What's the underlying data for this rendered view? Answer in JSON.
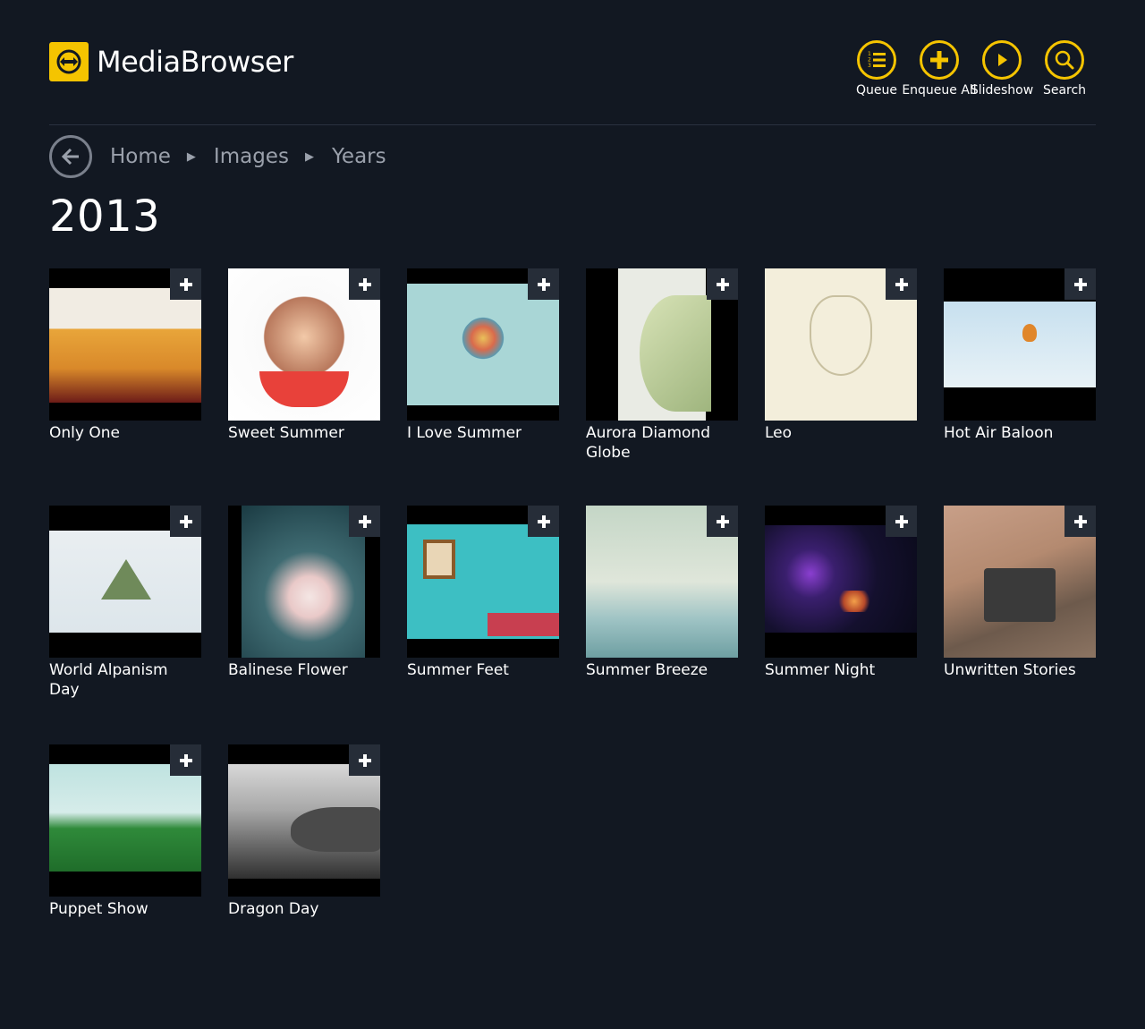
{
  "app": {
    "logo_text_1": "Media",
    "logo_text_2": "Browser"
  },
  "toolbar": {
    "queue_label": "Queue",
    "enqueue_label": "Enqueue All",
    "slideshow_label": "Slideshow",
    "search_label": "Search"
  },
  "breadcrumb": {
    "home": "Home",
    "images": "Images",
    "years": "Years"
  },
  "page": {
    "title": "2013"
  },
  "colors": {
    "accent": "#f5c400",
    "background": "#121822"
  },
  "items": [
    {
      "title": "Only One"
    },
    {
      "title": "Sweet Summer"
    },
    {
      "title": "I Love Summer"
    },
    {
      "title": "Aurora Diamond Globe"
    },
    {
      "title": "Leo"
    },
    {
      "title": "Hot Air Baloon"
    },
    {
      "title": "World Alpanism Day"
    },
    {
      "title": "Balinese Flower"
    },
    {
      "title": "Summer Feet"
    },
    {
      "title": "Summer Breeze"
    },
    {
      "title": "Summer Night"
    },
    {
      "title": "Unwritten Stories"
    },
    {
      "title": "Puppet Show"
    },
    {
      "title": "Dragon Day"
    }
  ]
}
